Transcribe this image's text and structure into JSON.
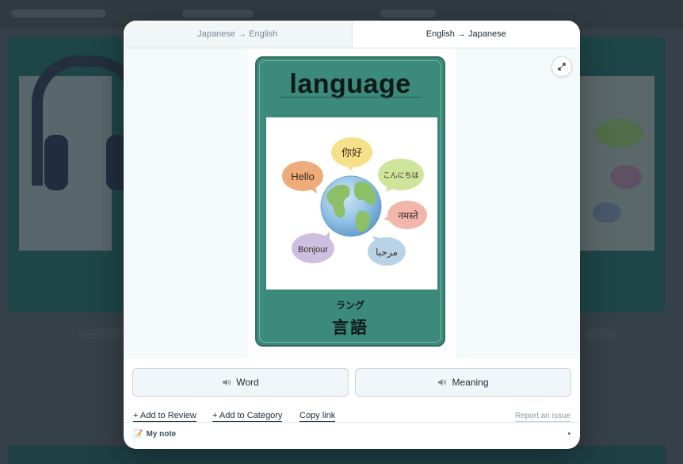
{
  "tabs": [
    {
      "label": "Japanese → English",
      "active": false
    },
    {
      "label": "English → Japanese",
      "active": true
    }
  ],
  "expand_icon": "expand-icon",
  "flashcard": {
    "word": "language",
    "reading": "ラング",
    "meaning": "言語",
    "colors": {
      "card": "#3c8a7c",
      "card_border": "#2f6d62"
    },
    "illustration": {
      "greetings": [
        "Hello",
        "你好",
        "こんにちは",
        "नमस्ते",
        "مرحبا",
        "Bonjour"
      ]
    }
  },
  "audio": {
    "word_label": "Word",
    "meaning_label": "Meaning",
    "icon": "speaker-icon"
  },
  "actions": {
    "add_to_review": "+ Add to Review",
    "add_to_category": "+ Add to Category",
    "copy_link": "Copy link",
    "report_issue": "Report an issue"
  },
  "note": {
    "icon": "📝",
    "label": "My note",
    "caret": "▾"
  }
}
